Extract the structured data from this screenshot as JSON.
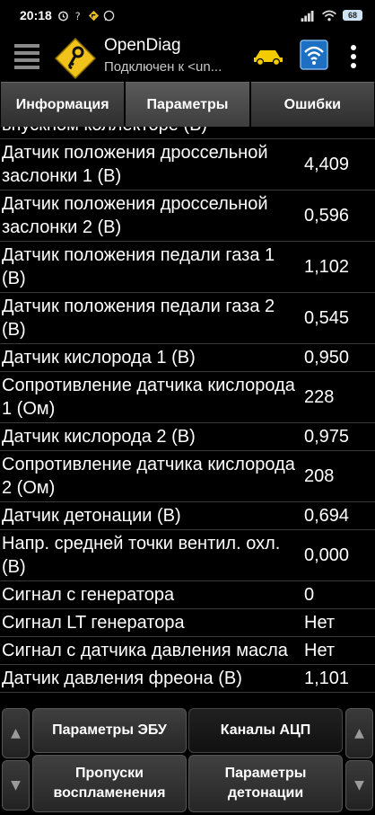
{
  "status_bar": {
    "time": "20:18",
    "battery": "68"
  },
  "app": {
    "title": "OpenDiag",
    "subtitle": "Подключен к <un..."
  },
  "tabs": [
    {
      "label": "Информация",
      "active": false
    },
    {
      "label": "Параметры",
      "active": true
    },
    {
      "label": "Ошибки",
      "active": false
    }
  ],
  "parameters": [
    {
      "label": "впускном коллекторе (В)",
      "value": ""
    },
    {
      "label": "Датчик положения дроссельной заслонки 1 (В)",
      "value": "4,409"
    },
    {
      "label": "Датчик положения дроссельной заслонки 2 (В)",
      "value": "0,596"
    },
    {
      "label": "Датчик положения педали газа 1 (В)",
      "value": "1,102"
    },
    {
      "label": "Датчик положения педали газа 2 (В)",
      "value": "0,545"
    },
    {
      "label": "Датчик кислорода 1 (В)",
      "value": "0,950"
    },
    {
      "label": "Сопротивление датчика кислорода 1 (Ом)",
      "value": "228"
    },
    {
      "label": "Датчик кислорода 2 (В)",
      "value": "0,975"
    },
    {
      "label": "Сопротивление датчика кислорода 2 (Ом)",
      "value": "208"
    },
    {
      "label": "Датчик детонации (В)",
      "value": "0,694"
    },
    {
      "label": "Напр. средней точки вентил. охл. (В)",
      "value": "0,000"
    },
    {
      "label": "Сигнал с генератора",
      "value": "0"
    },
    {
      "label": "Сигнал LT генератора",
      "value": "Нет"
    },
    {
      "label": "Сигнал с датчика давления масла",
      "value": "Нет"
    },
    {
      "label": "Датчик давления фреона (В)",
      "value": "1,101"
    }
  ],
  "bottom_buttons": {
    "ecu_params": "Параметры ЭБУ",
    "adc_channels": "Каналы АЦП",
    "misfires": "Пропуски воспламенения",
    "knock_params": "Параметры детонации",
    "arrow_up": "▲",
    "arrow_down": "▼"
  }
}
